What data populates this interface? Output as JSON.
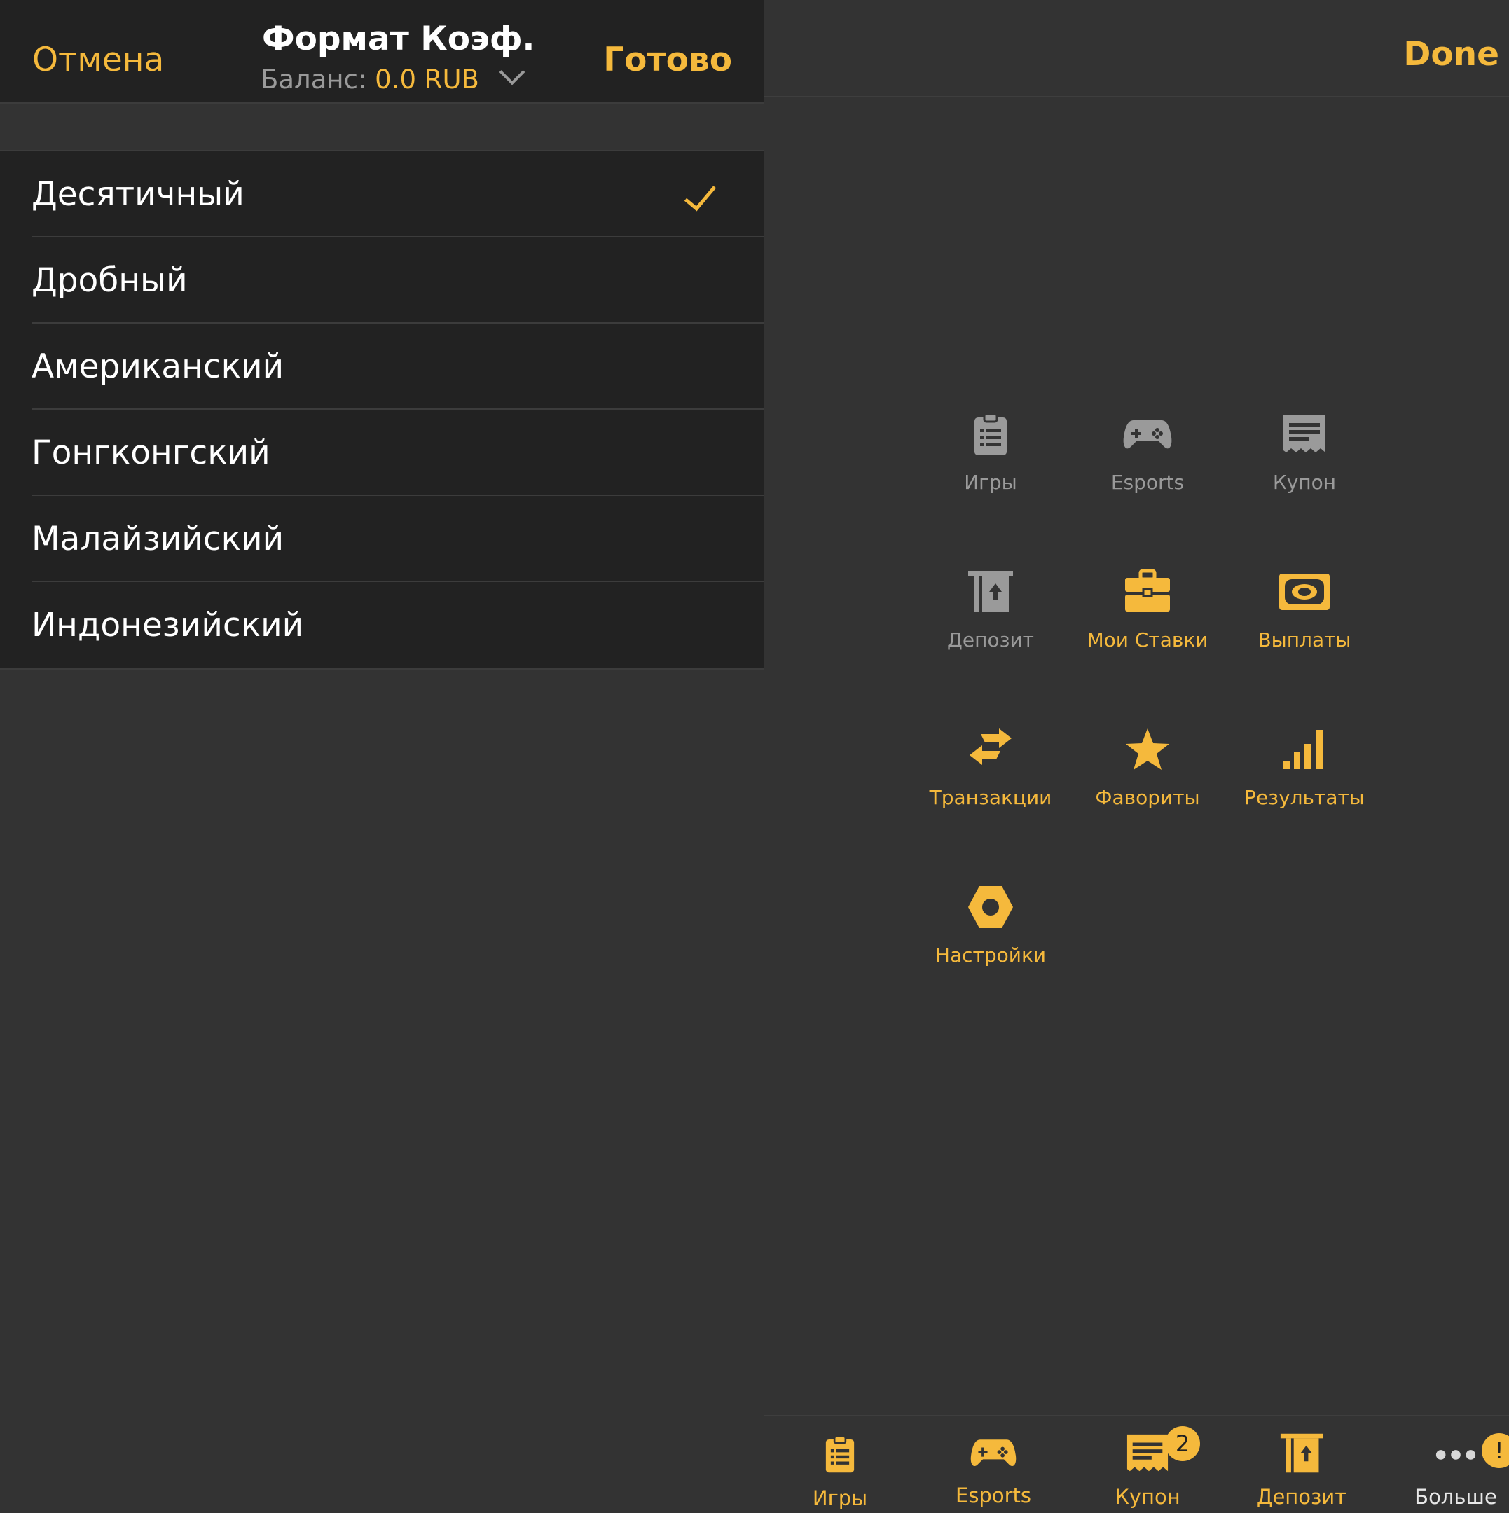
{
  "left_screen": {
    "nav": {
      "cancel_label": "Отмена",
      "title": "Формат Коэф.",
      "balance_label": "Баланс:",
      "balance_value": "0.0 RUB",
      "done_label": "Готово"
    },
    "odds_formats": [
      {
        "label": "Десятичный",
        "selected": true
      },
      {
        "label": "Дробный",
        "selected": false
      },
      {
        "label": "Американский",
        "selected": false
      },
      {
        "label": "Гонгконгский",
        "selected": false
      },
      {
        "label": "Малайзийский",
        "selected": false
      },
      {
        "label": "Индонезийский",
        "selected": false
      }
    ]
  },
  "right_screen": {
    "nav": {
      "done_label": "Done"
    },
    "menu_grid": [
      {
        "label": "Игры",
        "icon": "clipboard-list-icon",
        "state": "inactive"
      },
      {
        "label": "Esports",
        "icon": "gamepad-icon",
        "state": "inactive"
      },
      {
        "label": "Купон",
        "icon": "receipt-icon",
        "state": "inactive"
      },
      {
        "label": "Депозит",
        "icon": "deposit-atm-icon",
        "state": "inactive"
      },
      {
        "label": "Мои Ставки",
        "icon": "briefcase-icon",
        "state": "active"
      },
      {
        "label": "Выплаты",
        "icon": "banknote-icon",
        "state": "active"
      },
      {
        "label": "Транзакции",
        "icon": "transfer-arrows-icon",
        "state": "active"
      },
      {
        "label": "Фавориты",
        "icon": "star-icon",
        "state": "active"
      },
      {
        "label": "Результаты",
        "icon": "bar-chart-icon",
        "state": "active"
      },
      {
        "label": "Настройки",
        "icon": "hex-nut-settings-icon",
        "state": "active"
      }
    ],
    "tabbar": [
      {
        "label": "Игры",
        "icon": "clipboard-list-icon"
      },
      {
        "label": "Esports",
        "icon": "gamepad-icon"
      },
      {
        "label": "Купон",
        "icon": "receipt-icon",
        "badge": "2"
      },
      {
        "label": "Депозит",
        "icon": "deposit-atm-icon"
      },
      {
        "label": "Больше",
        "icon": "more-dots-icon",
        "badge": "!"
      }
    ],
    "colors": {
      "accent": "#F5B93C",
      "inactive": "#9A9A9A",
      "background": "#333333",
      "panel": "#222222"
    }
  }
}
